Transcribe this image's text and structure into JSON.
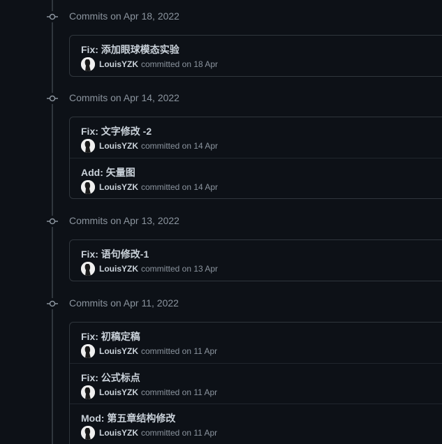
{
  "groups": [
    {
      "title": "Commits on Apr 18, 2022",
      "commits": [
        {
          "message": "Fix: 添加眼球模态实验",
          "author": "LouisYZK",
          "when": "committed on 18 Apr"
        }
      ]
    },
    {
      "title": "Commits on Apr 14, 2022",
      "commits": [
        {
          "message": "Fix: 文字修改 -2",
          "author": "LouisYZK",
          "when": "committed on 14 Apr"
        },
        {
          "message": "Add: 矢量图",
          "author": "LouisYZK",
          "when": "committed on 14 Apr"
        }
      ]
    },
    {
      "title": "Commits on Apr 13, 2022",
      "commits": [
        {
          "message": "Fix: 语句修改-1",
          "author": "LouisYZK",
          "when": "committed on 13 Apr"
        }
      ]
    },
    {
      "title": "Commits on Apr 11, 2022",
      "commits": [
        {
          "message": "Fix: 初稿定稿",
          "author": "LouisYZK",
          "when": "committed on 11 Apr"
        },
        {
          "message": "Fix: 公式标点",
          "author": "LouisYZK",
          "when": "committed on 11 Apr"
        },
        {
          "message": "Mod: 第五章结构修改",
          "author": "LouisYZK",
          "when": "committed on 11 Apr"
        }
      ]
    }
  ],
  "icons": {
    "timeline_marker": "git-commit-icon",
    "avatar": "user-avatar"
  },
  "colors": {
    "background": "#0d1117",
    "border": "#30363d",
    "muted_text": "#8b949e",
    "primary_text": "#c9d1d9"
  }
}
